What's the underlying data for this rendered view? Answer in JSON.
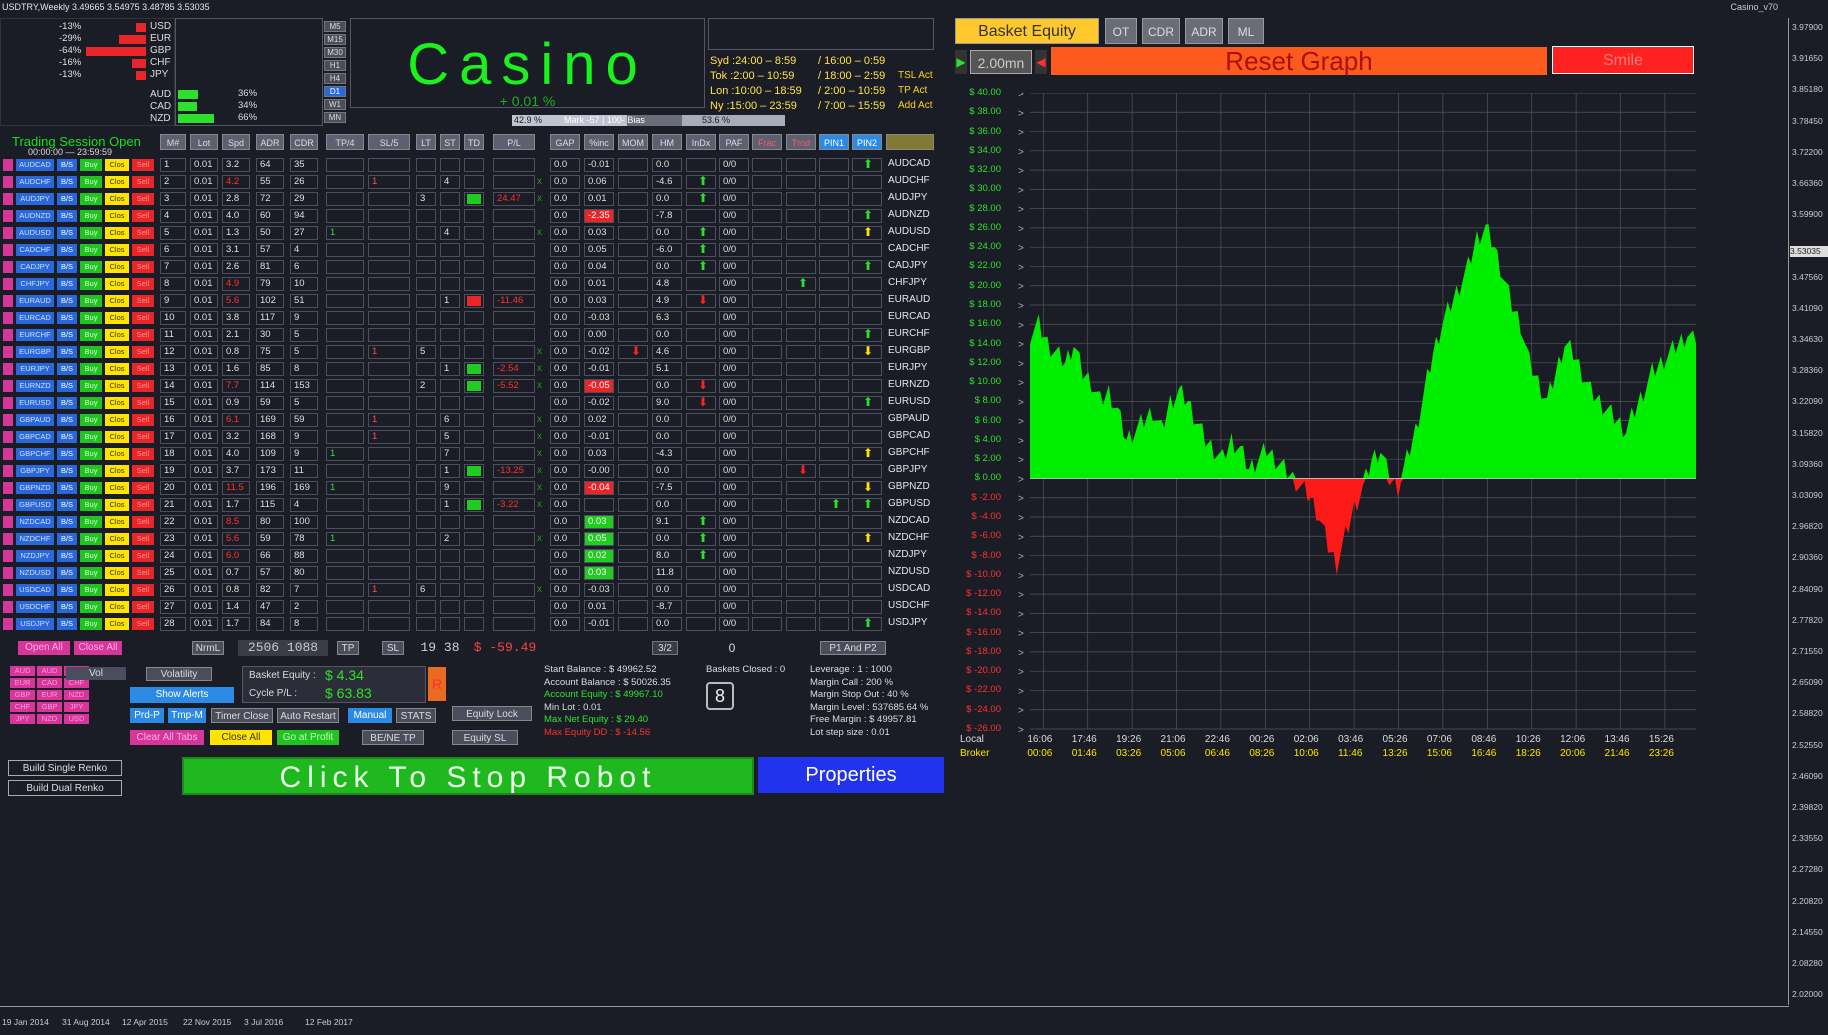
{
  "window": {
    "title": "USDTRY,Weekly  3.49665 3.54975 3.48785 3.53035",
    "brand": "Casino_v70"
  },
  "strength": {
    "neg": [
      {
        "v": "-13%",
        "c": "USD",
        "w": 10
      },
      {
        "v": "-29%",
        "c": "EUR",
        "w": 27
      },
      {
        "v": "-64%",
        "c": "GBP",
        "w": 60
      },
      {
        "v": "-16%",
        "c": "CHF",
        "w": 14
      },
      {
        "v": "-13%",
        "c": "JPY",
        "w": 10
      }
    ],
    "pos": [
      {
        "v": "36%",
        "c": "AUD",
        "w": 36
      },
      {
        "v": "34%",
        "c": "CAD",
        "w": 34
      },
      {
        "v": "66%",
        "c": "NZD",
        "w": 66
      }
    ]
  },
  "timeframes": [
    "M5",
    "M15",
    "M30",
    "H1",
    "H4",
    "D1",
    "W1",
    "MN"
  ],
  "timeframes_active": "D1",
  "casino": {
    "title": "Casino",
    "percent": "+ 0.01 %"
  },
  "sessions": [
    {
      "a": "Syd :24:00 – 8:59",
      "b": "/  16:00 – 0:59",
      "c": ""
    },
    {
      "a": "Tok :2:00 – 10:59",
      "b": "/  18:00 – 2:59",
      "c": "TSL Act"
    },
    {
      "a": "Lon :10:00 – 18:59",
      "b": "/  2:00 – 10:59",
      "c": "TP Act"
    },
    {
      "a": "Ny :15:00 – 23:59",
      "b": "/  7:00 – 15:59",
      "c": "Add Act"
    }
  ],
  "bias": {
    "left": "42.9 %",
    "mid": "Mark  -57  |  100-  Bias",
    "right": "53.6 %"
  },
  "trading_session": {
    "title": "Trading Session Open",
    "time": "00:00:00 — 23:59:59"
  },
  "headers_left": [
    "M#",
    "Lot",
    "Spd",
    "ADR",
    "CDR",
    "TP/4",
    "SL/5",
    "LT",
    "ST",
    "TD",
    "P/L"
  ],
  "headers_right": [
    "GAP",
    "%inc",
    "MOM",
    "HM",
    "InDx",
    "PAF",
    "Frac",
    "Trnd",
    "PIN1",
    "PIN2"
  ],
  "row_buttons": {
    "bs": "B/S",
    "buy": "Buy",
    "clos": "Clos",
    "sell": "Sell"
  },
  "rows": [
    {
      "p": "AUDCAD",
      "m": "1",
      "lot": "0.01",
      "spd": "3.2",
      "adr": "64",
      "cdr": "35",
      "gap": "0.0",
      "inc": "-0.01",
      "hm": "0.0",
      "paf": "0/0",
      "a": "up",
      "ap": "pin2"
    },
    {
      "p": "AUDCHF",
      "m": "2",
      "lot": "0.01",
      "spd": "4.2",
      "adr": "55",
      "cdr": "26",
      "sl": "1",
      "st": "4",
      "x": true,
      "gap": "0.0",
      "inc": "0.06",
      "hm": "-4.6",
      "paf": "0/0",
      "a": "up",
      "ap": "hm"
    },
    {
      "p": "AUDJPY",
      "m": "3",
      "lot": "0.01",
      "spd": "2.8",
      "adr": "72",
      "cdr": "29",
      "lt": "3",
      "td": "g",
      "pl": "24.47",
      "x": true,
      "gap": "0.0",
      "inc": "0.01",
      "hm": "0.0",
      "paf": "0/0",
      "a": "up",
      "ap": "hm"
    },
    {
      "p": "AUDNZD",
      "m": "4",
      "lot": "0.01",
      "spd": "4.0",
      "adr": "60",
      "cdr": "94",
      "gap": "0.0",
      "inc": "-2.35",
      "incr": true,
      "hm": "-7.8",
      "paf": "0/0",
      "a": "up",
      "ap": "pin2"
    },
    {
      "p": "AUDUSD",
      "m": "5",
      "lot": "0.01",
      "spd": "1.3",
      "adr": "50",
      "cdr": "27",
      "tp": "1",
      "st": "4",
      "x": true,
      "gap": "0.0",
      "inc": "0.03",
      "hm": "0.0",
      "paf": "0/0",
      "a": "upy",
      "ap": "pin2",
      "a2": "up",
      "a2p": "hm"
    },
    {
      "p": "CADCHF",
      "m": "6",
      "lot": "0.01",
      "spd": "3.1",
      "adr": "57",
      "cdr": "4",
      "gap": "0.0",
      "inc": "0.05",
      "hm": "-6.0",
      "paf": "0/0",
      "a": "up",
      "ap": "hm"
    },
    {
      "p": "CADJPY",
      "m": "7",
      "lot": "0.01",
      "spd": "2.6",
      "adr": "81",
      "cdr": "6",
      "gap": "0.0",
      "inc": "0.04",
      "hm": "0.0",
      "paf": "0/0",
      "a": "up",
      "ap": "hm",
      "a2": "up",
      "a2p": "pin2"
    },
    {
      "p": "CHFJPY",
      "m": "8",
      "lot": "0.01",
      "spd": "4.9",
      "adr": "79",
      "cdr": "10",
      "gap": "0.0",
      "inc": "0.01",
      "hm": "4.8",
      "paf": "0/0",
      "a": "up",
      "ap": "trnd"
    },
    {
      "p": "EURAUD",
      "m": "9",
      "lot": "0.01",
      "spd": "5.6",
      "adr": "102",
      "cdr": "51",
      "st": "1",
      "td": "r",
      "pl": "-11.46",
      "gap": "0.0",
      "inc": "0.03",
      "hm": "4.9",
      "paf": "0/0",
      "a": "down",
      "ap": "hm"
    },
    {
      "p": "EURCAD",
      "m": "10",
      "lot": "0.01",
      "spd": "3.8",
      "adr": "117",
      "cdr": "9",
      "gap": "0.0",
      "inc": "-0.03",
      "hm": "6.3",
      "paf": "0/0"
    },
    {
      "p": "EURCHF",
      "m": "11",
      "lot": "0.01",
      "spd": "2.1",
      "adr": "30",
      "cdr": "5",
      "gap": "0.0",
      "inc": "0.00",
      "hm": "0.0",
      "paf": "0/0",
      "a": "up",
      "ap": "pin2"
    },
    {
      "p": "EURGBP",
      "m": "12",
      "lot": "0.01",
      "spd": "0.8",
      "adr": "75",
      "cdr": "5",
      "sl": "1",
      "lt": "5",
      "x": true,
      "gap": "0.0",
      "inc": "-0.02",
      "hm": "4.6",
      "paf": "0/0",
      "a": "down",
      "ap": "mom",
      "a2": "downy",
      "a2p": "pin2"
    },
    {
      "p": "EURJPY",
      "m": "13",
      "lot": "0.01",
      "spd": "1.6",
      "adr": "85",
      "cdr": "8",
      "st": "1",
      "td": "g",
      "pl": "-2.54",
      "x": true,
      "gap": "0.0",
      "inc": "-0.01",
      "hm": "5.1",
      "paf": "0/0"
    },
    {
      "p": "EURNZD",
      "m": "14",
      "lot": "0.01",
      "spd": "7.7",
      "adr": "114",
      "cdr": "153",
      "lt": "2",
      "td": "g",
      "pl": "-5.52",
      "x": true,
      "gap": "0.0",
      "inc": "-0.05",
      "incr": true,
      "hm": "0.0",
      "paf": "0/0",
      "a": "down",
      "ap": "hm"
    },
    {
      "p": "EURUSD",
      "m": "15",
      "lot": "0.01",
      "spd": "0.9",
      "adr": "59",
      "cdr": "5",
      "gap": "0.0",
      "inc": "-0.02",
      "hm": "9.0",
      "paf": "0/0",
      "a": "down",
      "ap": "hm",
      "a2": "up",
      "a2p": "pin2"
    },
    {
      "p": "GBPAUD",
      "m": "16",
      "lot": "0.01",
      "spd": "6.1",
      "adr": "169",
      "cdr": "59",
      "sl": "1",
      "st": "6",
      "x": true,
      "gap": "0.0",
      "inc": "0.02",
      "hm": "0.0",
      "paf": "0/0"
    },
    {
      "p": "GBPCAD",
      "m": "17",
      "lot": "0.01",
      "spd": "3.2",
      "adr": "168",
      "cdr": "9",
      "sl": "1",
      "st": "5",
      "x": true,
      "gap": "0.0",
      "inc": "-0.01",
      "hm": "0.0",
      "paf": "0/0"
    },
    {
      "p": "GBPCHF",
      "m": "18",
      "lot": "0.01",
      "spd": "4.0",
      "adr": "109",
      "cdr": "9",
      "tp": "1",
      "st": "7",
      "x": true,
      "gap": "0.0",
      "inc": "0.03",
      "hm": "-4.3",
      "paf": "0/0",
      "a": "upy",
      "ap": "pin2"
    },
    {
      "p": "GBPJPY",
      "m": "19",
      "lot": "0.01",
      "spd": "3.7",
      "adr": "173",
      "cdr": "11",
      "st": "1",
      "td": "g",
      "pl": "-13.25",
      "x": true,
      "gap": "0.0",
      "inc": "-0.00",
      "hm": "0.0",
      "paf": "0/0",
      "a": "down",
      "ap": "trnd"
    },
    {
      "p": "GBPNZD",
      "m": "20",
      "lot": "0.01",
      "spd": "11.5",
      "adr": "196",
      "cdr": "169",
      "tp": "1",
      "st": "9",
      "x": true,
      "gap": "0.0",
      "inc": "-0.04",
      "incr": true,
      "hm": "-7.5",
      "paf": "0/0",
      "a": "downy",
      "ap": "pin2"
    },
    {
      "p": "GBPUSD",
      "m": "21",
      "lot": "0.01",
      "spd": "1.7",
      "adr": "115",
      "cdr": "4",
      "st": "1",
      "td": "g",
      "pl": "-3.22",
      "x": true,
      "gap": "0.0",
      "inc": "",
      "hm": "0.0",
      "paf": "0/0",
      "a": "up",
      "ap": "pin1",
      "a2": "up",
      "a2p": "pin2"
    },
    {
      "p": "NZDCAD",
      "m": "22",
      "lot": "0.01",
      "spd": "8.5",
      "adr": "80",
      "cdr": "100",
      "gap": "0.0",
      "inc": "0.03",
      "incg": true,
      "hm": "9.1",
      "paf": "0/0",
      "a": "up",
      "ap": "hm"
    },
    {
      "p": "NZDCHF",
      "m": "23",
      "lot": "0.01",
      "spd": "5.6",
      "adr": "59",
      "cdr": "78",
      "tp": "1",
      "st": "2",
      "x": true,
      "gap": "0.0",
      "inc": "0.05",
      "incg": true,
      "hm": "0.0",
      "paf": "0/0",
      "a": "up",
      "ap": "hm",
      "a2": "upy",
      "a2p": "pin2"
    },
    {
      "p": "NZDJPY",
      "m": "24",
      "lot": "0.01",
      "spd": "6.0",
      "adr": "66",
      "cdr": "88",
      "gap": "0.0",
      "inc": "0.02",
      "incg": true,
      "hm": "8.0",
      "paf": "0/0",
      "a": "up",
      "ap": "hm"
    },
    {
      "p": "NZDUSD",
      "m": "25",
      "lot": "0.01",
      "spd": "0.7",
      "adr": "57",
      "cdr": "80",
      "gap": "0.0",
      "inc": "0.03",
      "incg": true,
      "hm": "11.8",
      "paf": "0/0"
    },
    {
      "p": "USDCAD",
      "m": "26",
      "lot": "0.01",
      "spd": "0.8",
      "adr": "82",
      "cdr": "7",
      "sl": "1",
      "lt": "6",
      "x": true,
      "gap": "0.0",
      "inc": "-0.03",
      "hm": "0.0",
      "paf": "0/0"
    },
    {
      "p": "USDCHF",
      "m": "27",
      "lot": "0.01",
      "spd": "1.4",
      "adr": "47",
      "cdr": "2",
      "gap": "0.0",
      "inc": "0.01",
      "hm": "-8.7",
      "paf": "0/0"
    },
    {
      "p": "USDJPY",
      "m": "28",
      "lot": "0.01",
      "spd": "1.7",
      "adr": "84",
      "cdr": "8",
      "gap": "0.0",
      "inc": "-0.01",
      "hm": "0.0",
      "paf": "0/0",
      "a": "up",
      "ap": "pin2"
    }
  ],
  "bottom": {
    "open_all": "Open All",
    "close_all": "Close All",
    "nrml": "NrmL",
    "nums": "2506  1088",
    "tp": "TP",
    "sl": "SL",
    "sl_vals": "19  38",
    "sl_money": "$  -59.49",
    "ratio": "3/2",
    "zero": "0",
    "p1p2": "P1 And P2",
    "vol": "Vol",
    "volatility": "Volatility",
    "show_alerts": "Show Alerts",
    "basket_equity_label": "Basket Equity :",
    "basket_equity": "$ 4.34",
    "cycle_pl_label": "Cycle P/L :",
    "cycle_pl": "$ 63.83",
    "r_btn": "R",
    "prd": "Prd-P",
    "tmp": "Tmp-M",
    "timer_close": "Timer Close",
    "auto_restart": "Auto Restart",
    "manual": "Manual",
    "stats": "STATS",
    "equity_lock": "Equity Lock",
    "clear_all_tabs": "Clear All Tabs",
    "close_all2": "Close All",
    "go_profit": "Go at Profit",
    "be_ne_tp": "BE/NE TP",
    "equity_sl": "Equity SL",
    "start_balance": "Start Balance :  $ 49962.52",
    "account_balance": "Account Balance :  $ 50026.35",
    "account_equity": "Account Equity :  $ 49967.10",
    "min_lot": "Min Lot :  0.01",
    "max_net_equity": "Max Net Equity :  $ 29.40",
    "max_equity_dd": "Max Equity DD :  $ -14.56",
    "baskets_closed": "Baskets Closed :  0",
    "baskets_num": "8",
    "leverage": "Leverage :  1 : 1000",
    "margin_call": "Margin Call :  200 %",
    "margin_stop": "Margin Stop Out :  40 %",
    "margin_level": "Margin Level :  537685.64 %",
    "free_margin": "Free Margin :  $ 49957.81",
    "lot_step": "Lot step size :  0.01",
    "build_single": "Build Single Renko",
    "build_dual": "Build Dual Renko",
    "click_stop": "Click  To  Stop  Robot",
    "properties": "Properties"
  },
  "mini_cur": [
    "AUD",
    "EUR",
    "GBP",
    "CHF",
    "JPY",
    "AUD",
    "CAD",
    "EUR",
    "GBP",
    "NZD",
    "CAD",
    "CHF",
    "NZD",
    "JPY",
    "USD"
  ],
  "graph": {
    "tabs": [
      "Basket Equity",
      "OT",
      "CDR",
      "ADR",
      "ML"
    ],
    "interval": "2.00mn",
    "reset": "Reset Graph",
    "smile": "Smile",
    "local_label": "Local",
    "broker_label": "Broker"
  },
  "chart_data": {
    "type": "area",
    "title": "",
    "ylim": [
      -26,
      40
    ],
    "y_ticks": [
      "$ 40.00",
      "$ 38.00",
      "$ 36.00",
      "$ 34.00",
      "$ 32.00",
      "$ 30.00",
      "$ 28.00",
      "$ 26.00",
      "$ 24.00",
      "$ 22.00",
      "$ 20.00",
      "$ 18.00",
      "$ 16.00",
      "$ 14.00",
      "$ 12.00",
      "$ 10.00",
      "$ 8.00",
      "$ 6.00",
      "$ 4.00",
      "$ 2.00",
      "$ 0.00",
      "$ -2.00",
      "$ -4.00",
      "$ -6.00",
      "$ -8.00",
      "$ -10.00",
      "$ -12.00",
      "$ -14.00",
      "$ -16.00",
      "$ -18.00",
      "$ -20.00",
      "$ -22.00",
      "$ -24.00",
      "$ -26.00"
    ],
    "x_local": [
      "16:06",
      "17:46",
      "19:26",
      "21:06",
      "22:46",
      "00:26",
      "02:06",
      "03:46",
      "05:26",
      "07:06",
      "08:46",
      "10:26",
      "12:06",
      "13:46",
      "15:26"
    ],
    "x_broker": [
      "00:06",
      "01:46",
      "03:26",
      "05:06",
      "06:46",
      "08:26",
      "10:06",
      "11:46",
      "13:26",
      "15:06",
      "16:46",
      "18:26",
      "20:06",
      "21:46",
      "23:26"
    ],
    "values": [
      15,
      16,
      14,
      13,
      12,
      14,
      11,
      10,
      8,
      9,
      7,
      4,
      5,
      6,
      7,
      5,
      8,
      9,
      8,
      6,
      4,
      3,
      2,
      4,
      3,
      1,
      2,
      3,
      2,
      1,
      0,
      -1,
      -2,
      -4,
      -7,
      -9,
      -6,
      -3,
      -1,
      2,
      3,
      0,
      -1,
      2,
      5,
      9,
      13,
      16,
      18,
      20,
      22,
      25,
      26,
      24,
      21,
      18,
      16,
      12,
      10,
      8,
      11,
      14,
      13,
      11,
      9,
      8,
      7,
      6,
      5,
      7,
      9,
      11,
      12,
      13,
      14,
      15,
      14
    ],
    "positive_color": "#00ee00",
    "negative_color": "#ff1a1a"
  },
  "price_axis": {
    "labels": [
      "3.97900",
      "3.91650",
      "3.85180",
      "3.78450",
      "3.72200",
      "3.66360",
      "3.59900",
      "3.53035",
      "3.47560",
      "3.41090",
      "3.34630",
      "3.28360",
      "3.22090",
      "3.15820",
      "3.09360",
      "3.03090",
      "2.96820",
      "2.90360",
      "2.84090",
      "2.77820",
      "2.71550",
      "2.65090",
      "2.58820",
      "2.52550",
      "2.46090",
      "2.39820",
      "2.33550",
      "2.27280",
      "2.20820",
      "2.14550",
      "2.08280",
      "2.02000"
    ]
  },
  "date_axis": [
    "19 Jan 2014",
    "31 Aug 2014",
    "12 Apr 2015",
    "22 Nov 2015",
    "3 Jul 2016",
    "12 Feb 2017"
  ]
}
